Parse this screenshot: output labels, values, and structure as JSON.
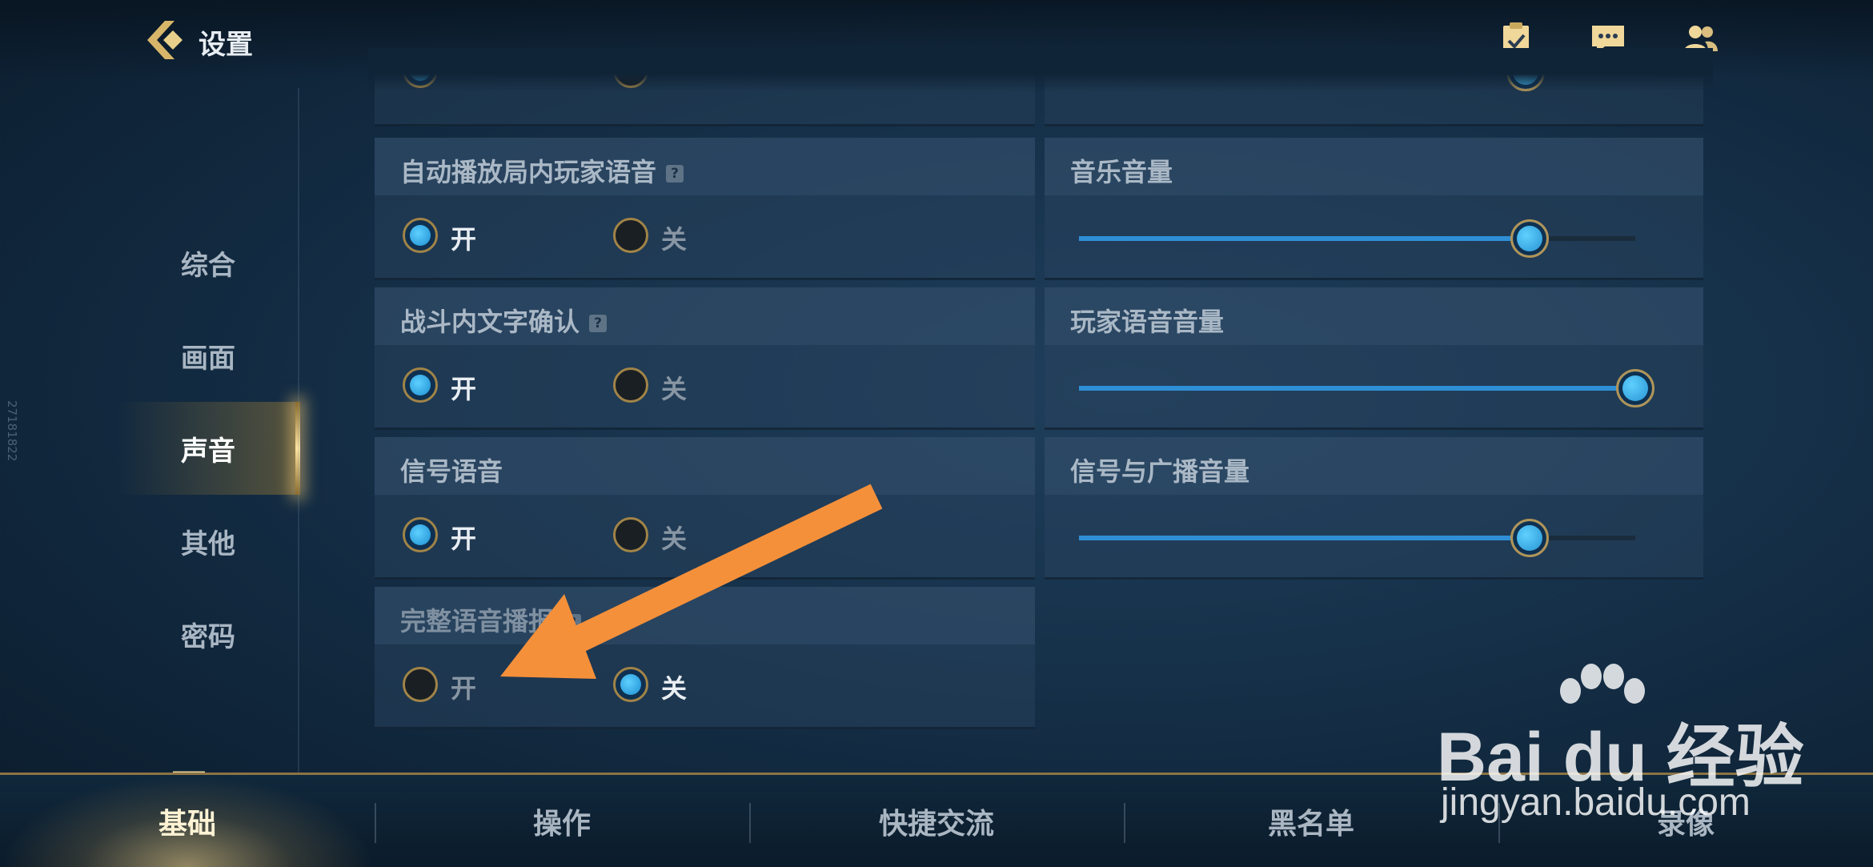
{
  "header": {
    "title": "设置",
    "icons": [
      "clipboard-check-icon",
      "chat-icon",
      "friends-icon"
    ]
  },
  "sidebar": {
    "items": [
      {
        "label": "综合"
      },
      {
        "label": "画面"
      },
      {
        "label": "声音"
      },
      {
        "label": "其他"
      },
      {
        "label": "密码"
      }
    ],
    "active": "声音",
    "code": "27181822"
  },
  "settings_left": [
    {
      "title": "自动播放局内玩家语音",
      "help": "?",
      "on_label": "开",
      "off_label": "关",
      "selected": "开"
    },
    {
      "title": "战斗内文字确认",
      "help": "?",
      "on_label": "开",
      "off_label": "关",
      "selected": "开"
    },
    {
      "title": "信号语音",
      "on_label": "开",
      "off_label": "关",
      "selected": "开"
    },
    {
      "title": "完整语音播报",
      "help": "?",
      "on_label": "开",
      "off_label": "关",
      "selected": "关"
    }
  ],
  "settings_right": [
    {
      "title": "音乐音量",
      "value_fraction": 0.81
    },
    {
      "title": "玩家语音音量",
      "value_fraction": 1.0
    },
    {
      "title": "信号与广播音量",
      "value_fraction": 0.81
    }
  ],
  "tabs": [
    {
      "label": "基础"
    },
    {
      "label": "操作"
    },
    {
      "label": "快捷交流"
    },
    {
      "label": "黑名单"
    },
    {
      "label": "录像"
    }
  ],
  "active_tab": "基础",
  "watermark": {
    "brand": "Bai du 经验",
    "url": "jingyan.baidu.com"
  },
  "colors": {
    "accent_gold": "#a18447",
    "toggle_blue": "#1c8ed0",
    "annotation_orange": "#f5903a"
  }
}
